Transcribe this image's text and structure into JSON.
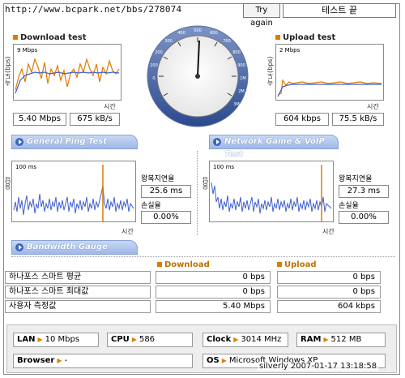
{
  "topbar": {
    "url": "http://www.bcpark.net/bbs/278074",
    "try_again_label": "Try again",
    "status_text": "테스트 끝"
  },
  "download": {
    "title": "Download test",
    "ylabel": "속도(bps)",
    "max_label": "9 Mbps",
    "xlabel": "시간",
    "speed": "5.40 Mbps",
    "bytes": "675 kB/s"
  },
  "upload": {
    "title": "Upload test",
    "ylabel": "속도(bps)",
    "max_label": "2 Mbps",
    "xlabel": "시간",
    "speed": "604 kbps",
    "bytes": "75.5 kB/s"
  },
  "gauge": {
    "ticks": [
      "0",
      "100",
      "200",
      "300",
      "400",
      "500",
      "600",
      "700",
      "800",
      "900",
      "1M",
      "2M",
      "3M",
      "4M",
      "5M",
      "6M",
      "7M",
      "8M",
      "9M",
      "10M"
    ],
    "needle_value": "5.40 Mbps"
  },
  "ping": {
    "tab_label": "General Ping Test",
    "ylabel": "응답(ms)",
    "max_label": "100 ms",
    "xlabel": "시간",
    "rtt_label": "왕복지연율",
    "rtt_value": "25.6 ms",
    "loss_label": "손실율",
    "loss_value": "0.00%"
  },
  "game": {
    "tab_label": "Network Game & VoIP Test",
    "ylabel": "응답(ms)",
    "max_label": "100 ms",
    "xlabel": "시간",
    "rtt_label": "왕복지연율",
    "rtt_value": "27.3 ms",
    "loss_label": "손실율",
    "loss_value": "0.00%"
  },
  "bandwidth": {
    "tab_label": "Bandwidth Gauge",
    "download_header": "Download",
    "upload_header": "Upload",
    "rows": [
      {
        "label": "하나포스 스마트 평균",
        "down": "0 bps",
        "up": "0 bps"
      },
      {
        "label": "하나포스 스마트 최대값",
        "down": "0 bps",
        "up": "0 bps"
      },
      {
        "label": "사용자 측정값",
        "down": "5.40 Mbps",
        "up": "604 kbps"
      }
    ]
  },
  "system": {
    "lan_label": "LAN",
    "lan_value": "10 Mbps",
    "cpu_label": "CPU",
    "cpu_value": "586",
    "clock_label": "Clock",
    "clock_value": "3014 MHz",
    "ram_label": "RAM",
    "ram_value": "512 MB",
    "browser_label": "Browser",
    "browser_value": "-",
    "os_label": "OS",
    "os_value": "Microsoft Windows XP"
  },
  "footer": {
    "user": "silverly",
    "datetime": "2007-01-17 13:18:58"
  },
  "colors": {
    "download_line": "#e07a00",
    "series_line": "#3e5fcf",
    "tab_blue": "#9fb8e8",
    "accent_orange": "#e08000"
  }
}
